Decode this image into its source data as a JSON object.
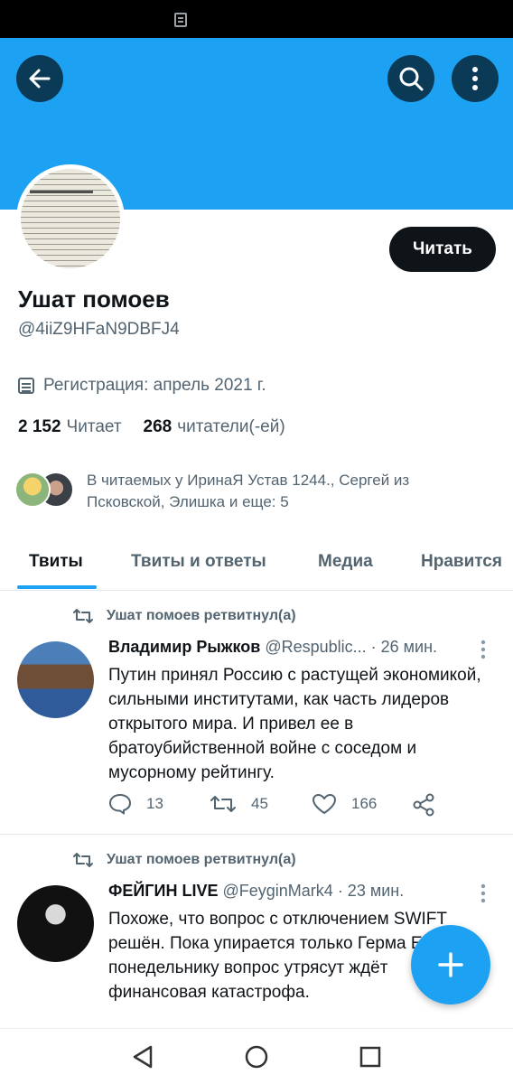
{
  "profile": {
    "follow_label": "Читать",
    "display_name": "Ушат помоев",
    "handle": "@4iiZ9HFaN9DBFJ4",
    "joined": "Регистрация: апрель 2021 г.",
    "following_count": "2 152",
    "following_label": "Читает",
    "followers_count": "268",
    "followers_label": "читатели(-ей)",
    "mutuals_text": "В читаемых у ИринаЯ Устав 1244., Сергей из Псковской, Элишка и еще: 5"
  },
  "tabs": [
    {
      "label": "Твиты",
      "active": true
    },
    {
      "label": "Твиты и ответы",
      "active": false
    },
    {
      "label": "Медиа",
      "active": false
    },
    {
      "label": "Нравится",
      "active": false
    }
  ],
  "tweets": [
    {
      "retweet_label": "Ушат помоев ретвитнул(а)",
      "author": "Владимир Рыжков",
      "handle": "@Respublic...",
      "time": "· 26 мин.",
      "text": "Путин принял Россию с растущей экономикой, сильными институтами, как часть лидеров открытого мира. И привел ее в братоубийственной войне с соседом и мусорному рейтингу.",
      "replies": "13",
      "retweets": "45",
      "likes": "166"
    },
    {
      "retweet_label": "Ушат помоев ретвитнул(а)",
      "author": "ФЕЙГИН LIVE",
      "handle": "@FeyginMark4",
      "time": "· 23 мин.",
      "text": "Похоже, что вопрос с отключением SWIFT решён. Пока упирается только Герма Если к понедельнику вопрос утрясут ждёт финансовая катастрофа."
    }
  ],
  "icons": {
    "back": "arrow-left-icon",
    "search": "search-icon",
    "more": "more-vertical-icon",
    "calendar": "calendar-icon",
    "retweet": "retweet-icon",
    "reply": "reply-icon",
    "like": "heart-icon",
    "share": "share-icon",
    "compose": "plus-icon"
  },
  "colors": {
    "accent": "#1da1f2",
    "dark_button": "#0b3a57",
    "text_primary": "#0f1419",
    "text_secondary": "#536471"
  }
}
